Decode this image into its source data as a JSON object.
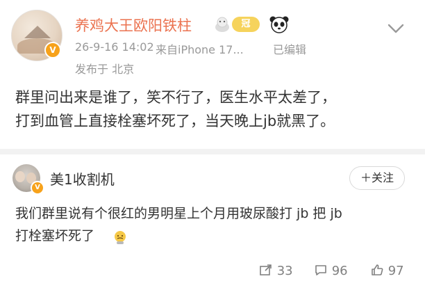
{
  "post": {
    "username": "养鸡大王欧阳铁柱",
    "badge_text": "冠",
    "timestamp": "26-9-16 14:02",
    "source": "来自iPhone 17...",
    "edited": "已编辑",
    "location": "发布于 北京",
    "content_line1": "群里问出来是谁了，笑不行了，医生水平太差了，",
    "content_line2": "打到血管上直接栓塞坏死了，当天晚上jb就黑了。"
  },
  "comment": {
    "username": "美1收割机",
    "follow_label": "＋关注",
    "text_line1": "我们群里说有个很红的男明星上个月用玻尿酸打 jb 把 jb",
    "text_line2": "打栓塞坏死了"
  },
  "actions": {
    "reposts": "33",
    "comments": "96",
    "likes": "97"
  },
  "colors": {
    "username": "#eb7350",
    "verify_badge": "#f7a21b",
    "meta": "#999999",
    "text": "#333333"
  }
}
